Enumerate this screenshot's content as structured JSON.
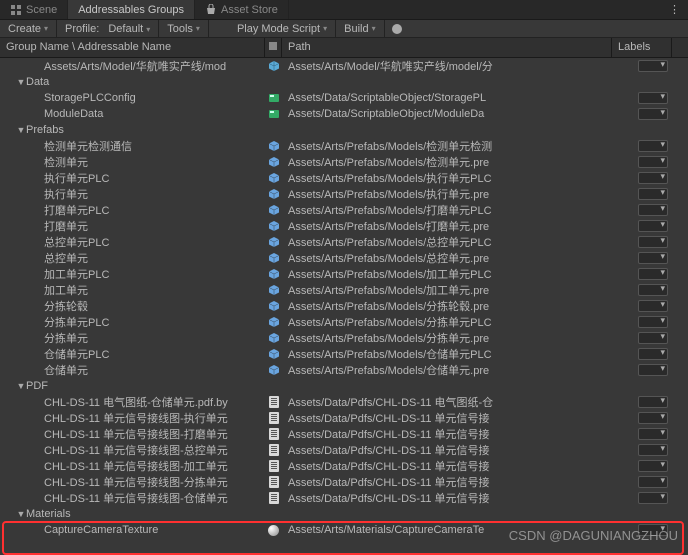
{
  "tabs": {
    "scene": "Scene",
    "addr": "Addressables Groups",
    "store": "Asset Store"
  },
  "toolbar": {
    "create": "Create",
    "profile_label": "Profile:",
    "profile_value": "Default",
    "tools": "Tools",
    "playmode": "Play Mode Script",
    "build": "Build"
  },
  "headers": {
    "name": "Group Name \\ Addressable Name",
    "path": "Path",
    "labels": "Labels"
  },
  "rows": [
    {
      "i": 2,
      "n": "Assets/Arts/Model/华航唯实产线/mod",
      "ic": "cube",
      "p": "Assets/Arts/Model/华航唯实产线/model/分"
    },
    {
      "g": true,
      "i": 1,
      "n": "Data"
    },
    {
      "i": 2,
      "n": "StoragePLCConfig",
      "ic": "so",
      "p": "Assets/Data/ScriptableObject/StoragePL"
    },
    {
      "i": 2,
      "n": "ModuleData",
      "ic": "so",
      "p": "Assets/Data/ScriptableObject/ModuleDa"
    },
    {
      "g": true,
      "i": 1,
      "n": "Prefabs"
    },
    {
      "i": 2,
      "n": "检测单元检测通信",
      "ic": "prefab",
      "p": "Assets/Arts/Prefabs/Models/检测单元检测"
    },
    {
      "i": 2,
      "n": "检测单元",
      "ic": "prefab",
      "p": "Assets/Arts/Prefabs/Models/检测单元.pre"
    },
    {
      "i": 2,
      "n": "执行单元PLC",
      "ic": "prefab",
      "p": "Assets/Arts/Prefabs/Models/执行单元PLC"
    },
    {
      "i": 2,
      "n": "执行单元",
      "ic": "prefab",
      "p": "Assets/Arts/Prefabs/Models/执行单元.pre"
    },
    {
      "i": 2,
      "n": "打磨单元PLC",
      "ic": "prefab",
      "p": "Assets/Arts/Prefabs/Models/打磨单元PLC"
    },
    {
      "i": 2,
      "n": "打磨单元",
      "ic": "prefab",
      "p": "Assets/Arts/Prefabs/Models/打磨单元.pre"
    },
    {
      "i": 2,
      "n": "总控单元PLC",
      "ic": "prefab",
      "p": "Assets/Arts/Prefabs/Models/总控单元PLC"
    },
    {
      "i": 2,
      "n": "总控单元",
      "ic": "prefab",
      "p": "Assets/Arts/Prefabs/Models/总控单元.pre"
    },
    {
      "i": 2,
      "n": "加工单元PLC",
      "ic": "prefab",
      "p": "Assets/Arts/Prefabs/Models/加工单元PLC"
    },
    {
      "i": 2,
      "n": "加工单元",
      "ic": "prefab",
      "p": "Assets/Arts/Prefabs/Models/加工单元.pre"
    },
    {
      "i": 2,
      "n": "分拣轮毂",
      "ic": "prefab",
      "p": "Assets/Arts/Prefabs/Models/分拣轮毂.pre"
    },
    {
      "i": 2,
      "n": "分拣单元PLC",
      "ic": "prefab",
      "p": "Assets/Arts/Prefabs/Models/分拣单元PLC"
    },
    {
      "i": 2,
      "n": "分拣单元",
      "ic": "prefab",
      "p": "Assets/Arts/Prefabs/Models/分拣单元.pre"
    },
    {
      "i": 2,
      "n": "仓储单元PLC",
      "ic": "prefab",
      "p": "Assets/Arts/Prefabs/Models/仓储单元PLC"
    },
    {
      "i": 2,
      "n": "仓储单元",
      "ic": "prefab",
      "p": "Assets/Arts/Prefabs/Models/仓储单元.pre"
    },
    {
      "g": true,
      "i": 1,
      "n": "PDF"
    },
    {
      "i": 2,
      "n": "CHL-DS-11 电气图纸-仓储单元.pdf.by",
      "ic": "doc",
      "p": "Assets/Data/Pdfs/CHL-DS-11 电气图纸-仓"
    },
    {
      "i": 2,
      "n": "CHL-DS-11 单元信号接线图-执行单元",
      "ic": "doc",
      "p": "Assets/Data/Pdfs/CHL-DS-11 单元信号接"
    },
    {
      "i": 2,
      "n": "CHL-DS-11 单元信号接线图-打磨单元",
      "ic": "doc",
      "p": "Assets/Data/Pdfs/CHL-DS-11 单元信号接"
    },
    {
      "i": 2,
      "n": "CHL-DS-11 单元信号接线图-总控单元",
      "ic": "doc",
      "p": "Assets/Data/Pdfs/CHL-DS-11 单元信号接"
    },
    {
      "i": 2,
      "n": "CHL-DS-11 单元信号接线图-加工单元",
      "ic": "doc",
      "p": "Assets/Data/Pdfs/CHL-DS-11 单元信号接"
    },
    {
      "i": 2,
      "n": "CHL-DS-11 单元信号接线图-分拣单元",
      "ic": "doc",
      "p": "Assets/Data/Pdfs/CHL-DS-11 单元信号接"
    },
    {
      "i": 2,
      "n": "CHL-DS-11 单元信号接线图-仓储单元",
      "ic": "doc",
      "p": "Assets/Data/Pdfs/CHL-DS-11 单元信号接"
    },
    {
      "g": true,
      "i": 1,
      "n": "Materials"
    },
    {
      "i": 2,
      "n": "CaptureCameraTexture",
      "ic": "mat",
      "p": "Assets/Arts/Materials/CaptureCameraTe"
    }
  ],
  "watermark": "CSDN @DAGUNIANGZHOU"
}
